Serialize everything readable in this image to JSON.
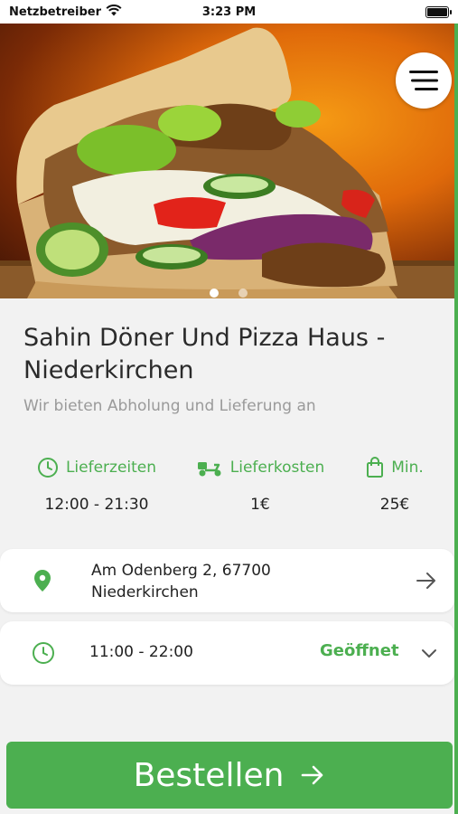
{
  "status_bar": {
    "carrier": "Netzbetreiber",
    "time": "3:23 PM",
    "battery_level": 1.0
  },
  "hero": {
    "image_icon": "doner-kebab-photo",
    "menu_icon": "hamburger-menu-icon",
    "carousel_pages": 2,
    "active_page": 1
  },
  "restaurant": {
    "name": "Sahin Döner Und Pizza Haus - Niederkirchen",
    "subtitle": "Wir bieten Abholung und Lieferung an"
  },
  "info": {
    "delivery_times": {
      "label": "Lieferzeiten",
      "value": "12:00 - 21:30",
      "icon": "clock-icon"
    },
    "delivery_costs": {
      "label": "Lieferkosten",
      "value": "1€",
      "icon": "scooter-icon"
    },
    "minimum": {
      "label": "Min.",
      "value": "25€",
      "icon": "shopping-bag-icon"
    }
  },
  "address": {
    "line1": "Am Odenberg 2, 67700",
    "line2": "Niederkirchen",
    "icon": "location-pin-icon"
  },
  "hours": {
    "value": "11:00 - 22:00",
    "status": "Geöffnet",
    "icon": "clock-icon"
  },
  "order_button": {
    "label": "Bestellen",
    "icon": "arrow-right-icon"
  },
  "colors": {
    "accent": "#4caf50",
    "background": "#f2f2f2",
    "card": "#ffffff"
  }
}
